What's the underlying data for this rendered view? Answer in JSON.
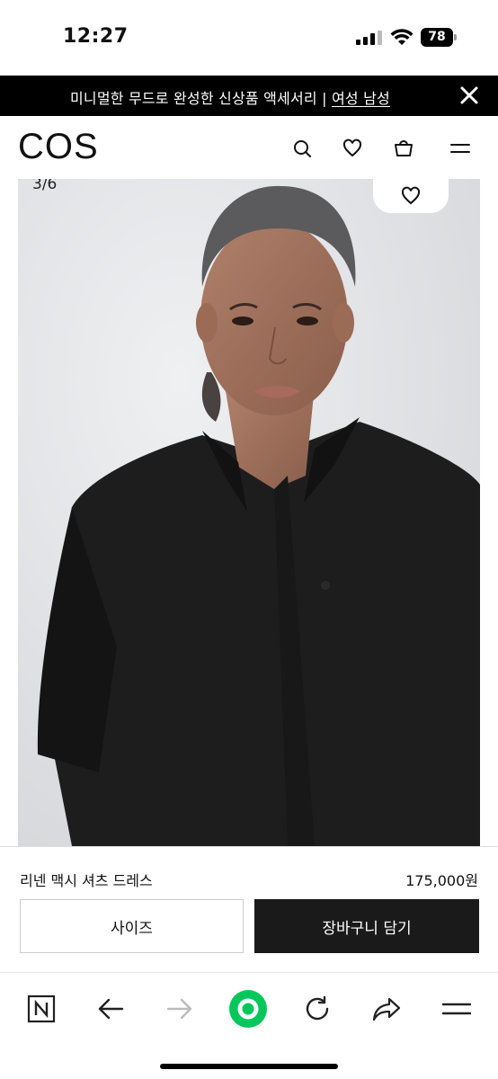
{
  "status_bar": {
    "time": "12:27",
    "battery": "78"
  },
  "promo": {
    "text": "미니멀한 무드로 완성한 신상품 액세서리 | ",
    "link": "여성 남성"
  },
  "header": {
    "logo": "COS"
  },
  "gallery": {
    "counter": "3/6"
  },
  "product": {
    "name": "리넨 맥시 셔츠 드레스",
    "price": "175,000원",
    "size_label": "사이즈",
    "cart_label": "장바구니 담기"
  },
  "colors": {
    "accent_green": "#03c75a",
    "dark": "#1a1a1a"
  },
  "toolbar_icons": [
    "naver-n-icon",
    "back-arrow-icon",
    "forward-arrow-icon",
    "green-home-icon",
    "refresh-icon",
    "share-icon",
    "menu-icon"
  ]
}
